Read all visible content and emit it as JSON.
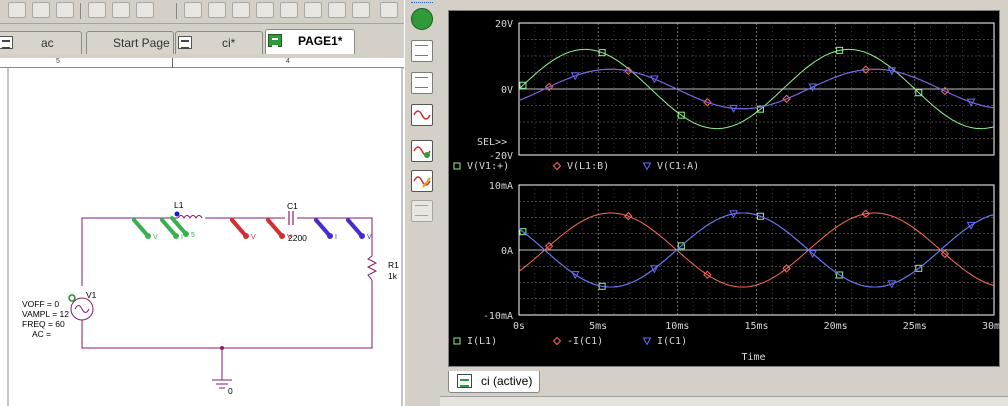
{
  "schematic_tabs": [
    {
      "label": "ac",
      "active": false
    },
    {
      "label": "Start Page",
      "active": false
    },
    {
      "label": "ci*",
      "active": false
    },
    {
      "label": "PAGE1*",
      "active": true
    }
  ],
  "ruler": {
    "left_mark": "5",
    "right_mark": "4"
  },
  "schematic": {
    "l1": {
      "name": "L1"
    },
    "c1": {
      "name": "C1",
      "value": "2200"
    },
    "r1": {
      "name": "R1",
      "value": "1k"
    },
    "v1": {
      "name": "V1",
      "voff": "VOFF = 0",
      "vampl": "VAMPL = 12",
      "freq": "FREQ = 60",
      "ac": "AC ="
    },
    "probes": [
      {
        "label": "V",
        "color": "#3ab050"
      },
      {
        "label": "I",
        "color": "#3ab050"
      },
      {
        "label": "5",
        "color": "#3ab050"
      },
      {
        "label": "V",
        "color": "#d03030"
      },
      {
        "label": "V",
        "color": "#d03030"
      },
      {
        "label": "I",
        "color": "#4a2ad0"
      },
      {
        "label": "V",
        "color": "#4a2ad0"
      }
    ],
    "ground": {
      "label": "0"
    }
  },
  "probe_tab": {
    "label": "ci (active)"
  },
  "sel_marker": "SEL>>",
  "chart_data": [
    {
      "type": "line",
      "xlabel": "",
      "ylabel": "",
      "xlim": [
        0,
        30
      ],
      "ylim": [
        -20,
        20
      ],
      "yticks": [
        "20V",
        "0V",
        "-20V"
      ],
      "grid": true,
      "series": [
        {
          "name": "V(V1:+)",
          "color": "#90f090",
          "marker": "square",
          "amplitude": 12,
          "freq_hz": 60,
          "phase_deg": 0,
          "offset": 0
        },
        {
          "name": "V(L1:B)",
          "color": "#ff6a5a",
          "marker": "diamond",
          "amplitude": 6,
          "freq_hz": 60,
          "phase_deg": -35,
          "offset": 0
        },
        {
          "name": "V(C1:A)",
          "color": "#6868ff",
          "marker": "triangle",
          "amplitude": 6,
          "freq_hz": 60,
          "phase_deg": -35,
          "offset": 0
        }
      ]
    },
    {
      "type": "line",
      "xlabel": "Time",
      "ylabel": "",
      "xlim": [
        0,
        30
      ],
      "ylim": [
        -10,
        10
      ],
      "xticks": [
        "0s",
        "5ms",
        "10ms",
        "15ms",
        "20ms",
        "25ms",
        "30ms"
      ],
      "yticks": [
        "10mA",
        "0A",
        "-10mA"
      ],
      "grid": true,
      "series": [
        {
          "name": "I(L1)",
          "color": "#90f090",
          "marker": "square",
          "amplitude": 5.7,
          "freq_hz": 60,
          "phase_deg": 145,
          "offset": 0
        },
        {
          "name": "-I(C1)",
          "color": "#ff6a5a",
          "marker": "diamond",
          "amplitude": 5.7,
          "freq_hz": 60,
          "phase_deg": -35,
          "offset": 0
        },
        {
          "name": "I(C1)",
          "color": "#6868ff",
          "marker": "triangle",
          "amplitude": 5.7,
          "freq_hz": 60,
          "phase_deg": 145,
          "offset": 0
        }
      ]
    }
  ]
}
